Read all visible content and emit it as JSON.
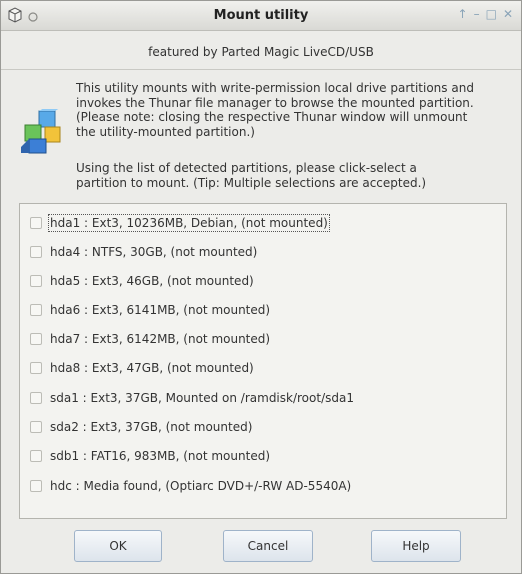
{
  "window": {
    "title": "Mount utility",
    "controls": [
      "↑",
      "–",
      "□",
      "✕"
    ]
  },
  "subtitle": "featured by Parted Magic LiveCD/USB",
  "intro_lines": [
    "This utility mounts with write-permission local drive partitions and",
    "invokes the Thunar file manager to browse the mounted partition.",
    "(Please note: closing the respective Thunar window will unmount",
    "the utility-mounted partition.)"
  ],
  "instruction_lines": [
    "Using the list of detected partitions, please click-select a",
    "partition to mount. (Tip: Multiple selections are accepted.)"
  ],
  "partitions": [
    {
      "label": "hda1 :  Ext3,  10236MB, Debian, (not mounted)",
      "checked": false
    },
    {
      "label": "hda4 :  NTFS,  30GB, (not mounted)",
      "checked": false
    },
    {
      "label": "hda5 :  Ext3,  46GB, (not mounted)",
      "checked": false
    },
    {
      "label": "hda6 :  Ext3,  6141MB, (not mounted)",
      "checked": false
    },
    {
      "label": "hda7 :  Ext3,  6142MB, (not mounted)",
      "checked": false
    },
    {
      "label": "hda8 :  Ext3,  47GB, (not mounted)",
      "checked": false
    },
    {
      "label": "sda1 :  Ext3,  37GB, Mounted on /ramdisk/root/sda1",
      "checked": false
    },
    {
      "label": "sda2 :  Ext3,  37GB, (not mounted)",
      "checked": false
    },
    {
      "label": "sdb1 :  FAT16,  983MB, (not mounted)",
      "checked": false
    },
    {
      "label": "hdc : Media found, (Optiarc DVD+/-RW AD-5540A)",
      "checked": false
    }
  ],
  "buttons": {
    "ok": "OK",
    "cancel": "Cancel",
    "help": "Help"
  },
  "colors": {
    "window_bg": "#ecece9",
    "button_border": "#9fb3c9",
    "title_text": "#222222"
  },
  "icons": {
    "title_app": "package-box-icon",
    "title_menu": "circle-menu-icon",
    "intro": "colored-cubes-icon"
  }
}
